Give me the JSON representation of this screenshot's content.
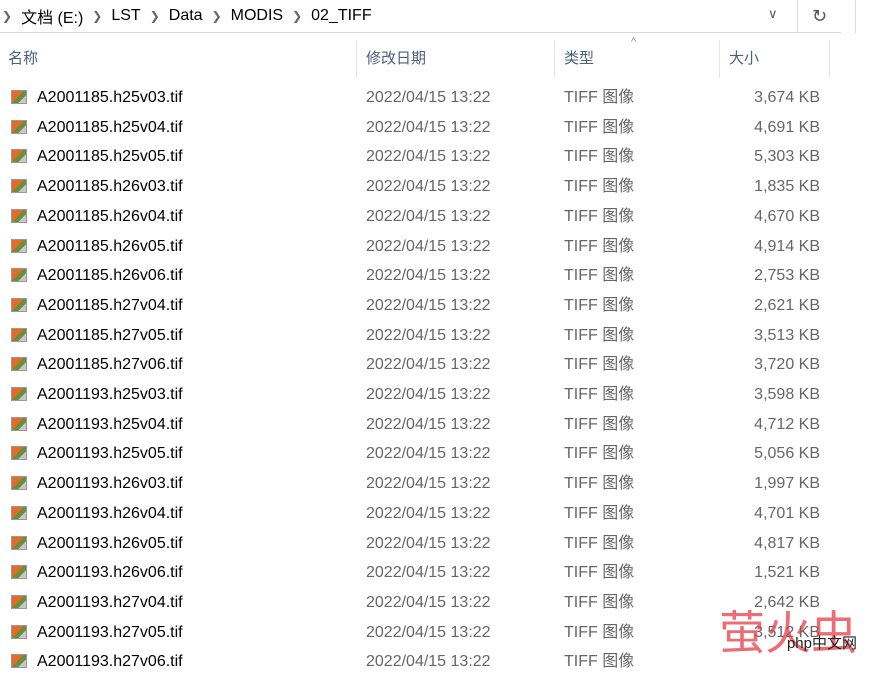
{
  "address": {
    "crumbs": [
      "文档 (E:)",
      "LST",
      "Data",
      "MODIS",
      "02_TIFF"
    ],
    "dropdown_icon": "chevron-down-icon",
    "refresh_icon": "refresh-icon"
  },
  "columns": {
    "name": "名称",
    "date": "修改日期",
    "type": "类型",
    "size": "大小"
  },
  "files": [
    {
      "name": "A2001185.h25v03.tif",
      "date": "2022/04/15 13:22",
      "type": "TIFF 图像",
      "size": "3,674 KB"
    },
    {
      "name": "A2001185.h25v04.tif",
      "date": "2022/04/15 13:22",
      "type": "TIFF 图像",
      "size": "4,691 KB"
    },
    {
      "name": "A2001185.h25v05.tif",
      "date": "2022/04/15 13:22",
      "type": "TIFF 图像",
      "size": "5,303 KB"
    },
    {
      "name": "A2001185.h26v03.tif",
      "date": "2022/04/15 13:22",
      "type": "TIFF 图像",
      "size": "1,835 KB"
    },
    {
      "name": "A2001185.h26v04.tif",
      "date": "2022/04/15 13:22",
      "type": "TIFF 图像",
      "size": "4,670 KB"
    },
    {
      "name": "A2001185.h26v05.tif",
      "date": "2022/04/15 13:22",
      "type": "TIFF 图像",
      "size": "4,914 KB"
    },
    {
      "name": "A2001185.h26v06.tif",
      "date": "2022/04/15 13:22",
      "type": "TIFF 图像",
      "size": "2,753 KB"
    },
    {
      "name": "A2001185.h27v04.tif",
      "date": "2022/04/15 13:22",
      "type": "TIFF 图像",
      "size": "2,621 KB"
    },
    {
      "name": "A2001185.h27v05.tif",
      "date": "2022/04/15 13:22",
      "type": "TIFF 图像",
      "size": "3,513 KB"
    },
    {
      "name": "A2001185.h27v06.tif",
      "date": "2022/04/15 13:22",
      "type": "TIFF 图像",
      "size": "3,720 KB"
    },
    {
      "name": "A2001193.h25v03.tif",
      "date": "2022/04/15 13:22",
      "type": "TIFF 图像",
      "size": "3,598 KB"
    },
    {
      "name": "A2001193.h25v04.tif",
      "date": "2022/04/15 13:22",
      "type": "TIFF 图像",
      "size": "4,712 KB"
    },
    {
      "name": "A2001193.h25v05.tif",
      "date": "2022/04/15 13:22",
      "type": "TIFF 图像",
      "size": "5,056 KB"
    },
    {
      "name": "A2001193.h26v03.tif",
      "date": "2022/04/15 13:22",
      "type": "TIFF 图像",
      "size": "1,997 KB"
    },
    {
      "name": "A2001193.h26v04.tif",
      "date": "2022/04/15 13:22",
      "type": "TIFF 图像",
      "size": "4,701 KB"
    },
    {
      "name": "A2001193.h26v05.tif",
      "date": "2022/04/15 13:22",
      "type": "TIFF 图像",
      "size": "4,817 KB"
    },
    {
      "name": "A2001193.h26v06.tif",
      "date": "2022/04/15 13:22",
      "type": "TIFF 图像",
      "size": "1,521 KB"
    },
    {
      "name": "A2001193.h27v04.tif",
      "date": "2022/04/15 13:22",
      "type": "TIFF 图像",
      "size": "2,642 KB"
    },
    {
      "name": "A2001193.h27v05.tif",
      "date": "2022/04/15 13:22",
      "type": "TIFF 图像",
      "size": "3,512 KB"
    },
    {
      "name": "A2001193.h27v06.tif",
      "date": "2022/04/15 13:22",
      "type": "TIFF 图像",
      "size": ""
    }
  ],
  "watermark": {
    "text": "萤火虫",
    "brand": "php中文网"
  }
}
